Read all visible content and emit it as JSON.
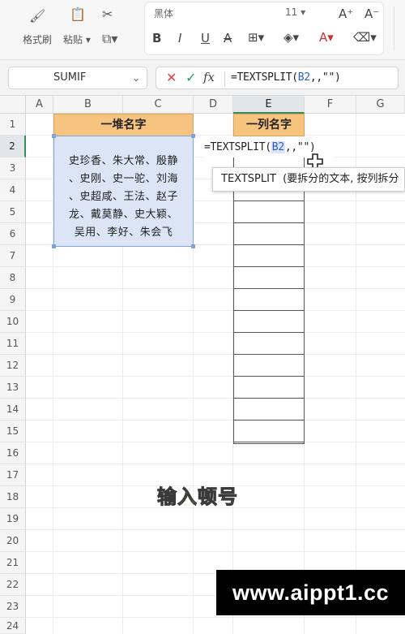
{
  "ribbon": {
    "format_painter_label": "格式刷",
    "paste_label": "粘贴",
    "font_name": "黑体",
    "font_size": "11",
    "bold": "B",
    "italic": "I",
    "underline": "U",
    "strike": "A"
  },
  "formula_bar": {
    "name_box": "SUMIF",
    "fx_label": "fx",
    "formula_prefix": "=TEXTSPLIT(",
    "formula_ref": "B2",
    "formula_suffix": ",,\"\")"
  },
  "grid": {
    "columns": [
      "A",
      "B",
      "C",
      "D",
      "E",
      "F",
      "G"
    ],
    "rows": [
      "1",
      "2",
      "3",
      "4",
      "5",
      "6",
      "7",
      "8",
      "9",
      "10",
      "11",
      "12",
      "13",
      "14",
      "15",
      "16",
      "17",
      "18",
      "19",
      "20",
      "21",
      "22",
      "23",
      "24"
    ],
    "selected_column": "E",
    "selected_row": "2"
  },
  "cells": {
    "b1_header": "一堆名字",
    "e1_header": "一列名字",
    "b2_lines": [
      "史珍香、朱大常、殷静",
      "、史刚、史一驼、刘海",
      "、史超咸、王法、赵子",
      "龙、戴莫静、史大颖、",
      "吴用、李好、朱会飞"
    ],
    "edit_prefix": "=TEXTSPLIT(",
    "edit_ref": "B2",
    "edit_suffix": ",,\"\")"
  },
  "tooltip": {
    "func_name": "TEXTSPLIT",
    "args": "(要拆分的文本, 按列拆分"
  },
  "caption": "输入顿号",
  "watermark": "www.aippt1.cc",
  "colors": {
    "header_fill": "#f6c47e",
    "text_block_fill": "#dbe5f6",
    "selection_green": "#3a8a5a",
    "reference_blue": "#2a5cc9",
    "caption_yellow": "#e8c12d"
  }
}
